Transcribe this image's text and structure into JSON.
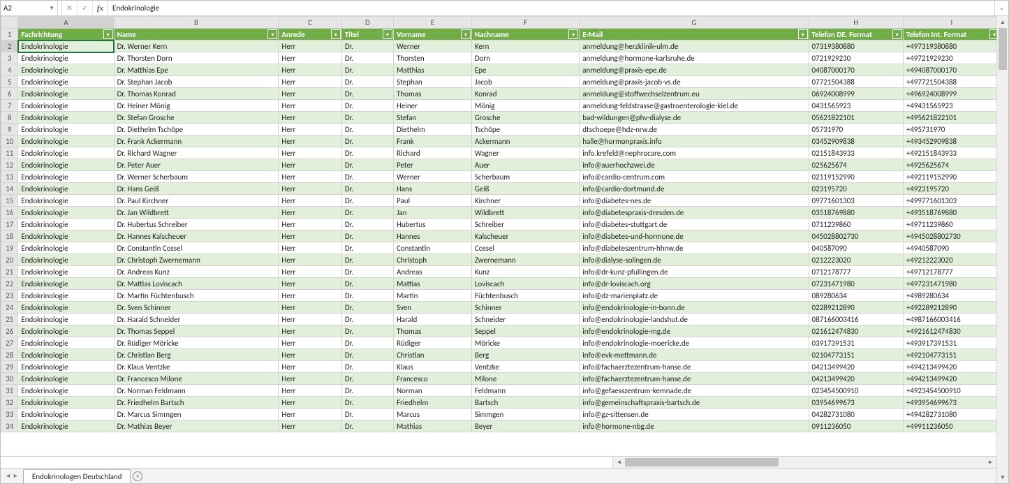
{
  "formula_bar": {
    "name_box": "A2",
    "formula": "Endokrinologie"
  },
  "sheet": {
    "tab_name": "Endokrinologen Deutschland"
  },
  "columns": [
    "A",
    "B",
    "C",
    "D",
    "E",
    "F",
    "G",
    "H",
    "I"
  ],
  "headers": {
    "A": "Fachrichtung",
    "B": "Name",
    "C": "Anrede",
    "D": "Titel",
    "E": "Vorname",
    "F": "Nachname",
    "G": "E-Mail",
    "H": "Telefon DE. Format",
    "I": "Telefon Int. Format"
  },
  "rows": [
    {
      "n": 2,
      "A": "Endokrinologie",
      "B": "Dr. Werner Kern",
      "C": "Herr",
      "D": "Dr.",
      "E": "Werner",
      "F": "Kern",
      "G": "anmeldung@herzklinik-ulm.de",
      "H": "07319380880",
      "I": "+497319380880"
    },
    {
      "n": 3,
      "A": "Endokrinologie",
      "B": "Dr. Thorsten Dorn",
      "C": "Herr",
      "D": "Dr.",
      "E": "Thorsten",
      "F": "Dorn",
      "G": "anmeldung@hormone-karlsruhe.de",
      "H": "0721929230",
      "I": "+49721929230"
    },
    {
      "n": 4,
      "A": "Endokrinologie",
      "B": "Dr. Matthias Epe",
      "C": "Herr",
      "D": "Dr.",
      "E": "Matthias",
      "F": "Epe",
      "G": "anmeldung@praxis-epe.de",
      "H": "04087000170",
      "I": "+494087000170"
    },
    {
      "n": 5,
      "A": "Endokrinologie",
      "B": "Dr. Stephan Jacob",
      "C": "Herr",
      "D": "Dr.",
      "E": "Stephan",
      "F": "Jacob",
      "G": "anmeldung@praxis-jacob-vs.de",
      "H": "07721504388",
      "I": "+497721504388"
    },
    {
      "n": 6,
      "A": "Endokrinologie",
      "B": "Dr. Thomas Konrad",
      "C": "Herr",
      "D": "Dr.",
      "E": "Thomas",
      "F": "Konrad",
      "G": "anmeldung@stoffwechselzentrum.eu",
      "H": "06924008999",
      "I": "+496924008999"
    },
    {
      "n": 7,
      "A": "Endokrinologie",
      "B": "Dr. Heiner Mönig",
      "C": "Herr",
      "D": "Dr.",
      "E": "Heiner",
      "F": "Mönig",
      "G": "anmeldung-feldstrasse@gastroenterologie-kiel.de",
      "H": "0431565923",
      "I": "+49431565923"
    },
    {
      "n": 8,
      "A": "Endokrinologie",
      "B": "Dr. Stefan Grosche",
      "C": "Herr",
      "D": "Dr.",
      "E": "Stefan",
      "F": "Grosche",
      "G": "bad-wildungen@phv-dialyse.de",
      "H": "05621822101",
      "I": "+495621822101"
    },
    {
      "n": 9,
      "A": "Endokrinologie",
      "B": "Dr. Diethelm Tschöpe",
      "C": "Herr",
      "D": "Dr.",
      "E": "Diethelm",
      "F": "Tschöpe",
      "G": "dtschoepe@hdz-nrw.de",
      "H": "05731970",
      "I": "+495731970"
    },
    {
      "n": 10,
      "A": "Endokrinologie",
      "B": "Dr. Frank Ackermann",
      "C": "Herr",
      "D": "Dr.",
      "E": "Frank",
      "F": "Ackermann",
      "G": "halle@hormonpraxis.info",
      "H": "03452909838",
      "I": "+493452909838"
    },
    {
      "n": 11,
      "A": "Endokrinologie",
      "B": "Dr. Richard Wagner",
      "C": "Herr",
      "D": "Dr.",
      "E": "Richard",
      "F": "Wagner",
      "G": "info.krefeld@nephrocare.com",
      "H": "02151843933",
      "I": "+492151843933"
    },
    {
      "n": 12,
      "A": "Endokrinologie",
      "B": "Dr. Peter Auer",
      "C": "Herr",
      "D": "Dr.",
      "E": "Peter",
      "F": "Auer",
      "G": "info@auerhochzwei.de",
      "H": "025625674",
      "I": "+4925625674"
    },
    {
      "n": 13,
      "A": "Endokrinologie",
      "B": "Dr. Werner Scherbaum",
      "C": "Herr",
      "D": "Dr.",
      "E": "Werner",
      "F": "Scherbaum",
      "G": "info@cardio-centrum.com",
      "H": "02119152990",
      "I": "+492119152990"
    },
    {
      "n": 14,
      "A": "Endokrinologie",
      "B": "Dr. Hans Geiß",
      "C": "Herr",
      "D": "Dr.",
      "E": "Hans",
      "F": "Geiß",
      "G": "info@cardio-dortmund.de",
      "H": "023195720",
      "I": "+4923195720"
    },
    {
      "n": 15,
      "A": "Endokrinologie",
      "B": "Dr. Paul Kirchner",
      "C": "Herr",
      "D": "Dr.",
      "E": "Paul",
      "F": "Kirchner",
      "G": "info@diabetes-nes.de",
      "H": "09771601303",
      "I": "+499771601303"
    },
    {
      "n": 16,
      "A": "Endokrinologie",
      "B": "Dr. Jan Wildbrett",
      "C": "Herr",
      "D": "Dr.",
      "E": "Jan",
      "F": "Wildbrett",
      "G": "info@diabetespraxis-dresden.de",
      "H": "03518769880",
      "I": "+493518769880"
    },
    {
      "n": 17,
      "A": "Endokrinologie",
      "B": "Dr. Hubertus Schreiber",
      "C": "Herr",
      "D": "Dr.",
      "E": "Hubertus",
      "F": "Schreiber",
      "G": "info@diabetes-stuttgart.de",
      "H": "0711239860",
      "I": "+49711239860"
    },
    {
      "n": 18,
      "A": "Endokrinologie",
      "B": "Dr. Hannes Kalscheuer",
      "C": "Herr",
      "D": "Dr.",
      "E": "Hannes",
      "F": "Kalscheuer",
      "G": "info@diabetes-und-hormone.de",
      "H": "045028802730",
      "I": "+4945028802730"
    },
    {
      "n": 19,
      "A": "Endokrinologie",
      "B": "Dr. Constantin Cossel",
      "C": "Herr",
      "D": "Dr.",
      "E": "Constantin",
      "F": "Cossel",
      "G": "info@diabeteszentrum-hhnw.de",
      "H": "040587090",
      "I": "+4940587090"
    },
    {
      "n": 20,
      "A": "Endokrinologie",
      "B": "Dr. Christoph Zwernemann",
      "C": "Herr",
      "D": "Dr.",
      "E": "Christoph",
      "F": "Zwernemann",
      "G": "info@dialyse-solingen.de",
      "H": "0212223020",
      "I": "+49212223020"
    },
    {
      "n": 21,
      "A": "Endokrinologie",
      "B": "Dr. Andreas Kunz",
      "C": "Herr",
      "D": "Dr.",
      "E": "Andreas",
      "F": "Kunz",
      "G": "info@dr-kunz-pfullingen.de",
      "H": "0712178777",
      "I": "+49712178777"
    },
    {
      "n": 22,
      "A": "Endokrinologie",
      "B": "Dr. Mattias Loviscach",
      "C": "Herr",
      "D": "Dr.",
      "E": "Mattias",
      "F": "Loviscach",
      "G": "info@dr-loviscach.org",
      "H": "07231471980",
      "I": "+497231471980"
    },
    {
      "n": 23,
      "A": "Endokrinologie",
      "B": "Dr. Martin Füchtenbusch",
      "C": "Herr",
      "D": "Dr.",
      "E": "Martin",
      "F": "Füchtenbusch",
      "G": "info@dz-marienplatz.de",
      "H": "089280634",
      "I": "+4989280634"
    },
    {
      "n": 24,
      "A": "Endokrinologie",
      "B": "Dr. Sven Schinner",
      "C": "Herr",
      "D": "Dr.",
      "E": "Sven",
      "F": "Schinner",
      "G": "info@endokrinologie-in-bonn.de",
      "H": "02289212890",
      "I": "+492289212890"
    },
    {
      "n": 25,
      "A": "Endokrinologie",
      "B": "Dr. Harald Schneider",
      "C": "Herr",
      "D": "Dr.",
      "E": "Harald",
      "F": "Schneider",
      "G": "info@endokrinologie-landshut.de",
      "H": "087166003416",
      "I": "+4987166003416"
    },
    {
      "n": 26,
      "A": "Endokrinologie",
      "B": "Dr. Thomas Seppel",
      "C": "Herr",
      "D": "Dr.",
      "E": "Thomas",
      "F": "Seppel",
      "G": "info@endokrinologie-mg.de",
      "H": "021612474830",
      "I": "+4921612474830"
    },
    {
      "n": 27,
      "A": "Endokrinologie",
      "B": "Dr. Rüdiger Möricke",
      "C": "Herr",
      "D": "Dr.",
      "E": "Rüdiger",
      "F": "Möricke",
      "G": "info@endokrinologie-moericke.de",
      "H": "03917391531",
      "I": "+493917391531"
    },
    {
      "n": 28,
      "A": "Endokrinologie",
      "B": "Dr. Christian Berg",
      "C": "Herr",
      "D": "Dr.",
      "E": "Christian",
      "F": "Berg",
      "G": "info@evk-mettmann.de",
      "H": "02104773151",
      "I": "+492104773151"
    },
    {
      "n": 29,
      "A": "Endokrinologie",
      "B": "Dr. Klaus Ventzke",
      "C": "Herr",
      "D": "Dr.",
      "E": "Klaus",
      "F": "Ventzke",
      "G": "info@fachaerztezentrum-hanse.de",
      "H": "04213499420",
      "I": "+494213499420"
    },
    {
      "n": 30,
      "A": "Endokrinologie",
      "B": "Dr. Francesco Milone",
      "C": "Herr",
      "D": "Dr.",
      "E": "Francesco",
      "F": "Milone",
      "G": "info@fachaerztezentrum-hanse.de",
      "H": "04213499420",
      "I": "+494213499420"
    },
    {
      "n": 31,
      "A": "Endokrinologie",
      "B": "Dr. Norman Feldmann",
      "C": "Herr",
      "D": "Dr.",
      "E": "Norman",
      "F": "Feldmann",
      "G": "info@gefaesszentrum-kemnade.de",
      "H": "023454500910",
      "I": "+4923454500910"
    },
    {
      "n": 32,
      "A": "Endokrinologie",
      "B": "Dr. Friedhelm Bartsch",
      "C": "Herr",
      "D": "Dr.",
      "E": "Friedhelm",
      "F": "Bartsch",
      "G": "info@gemeinschaftspraxis-bartsch.de",
      "H": "03954699673",
      "I": "+493954699673"
    },
    {
      "n": 33,
      "A": "Endokrinologie",
      "B": "Dr. Marcus Simmgen",
      "C": "Herr",
      "D": "Dr.",
      "E": "Marcus",
      "F": "Simmgen",
      "G": "info@gz-sittensen.de",
      "H": "04282731080",
      "I": "+494282731080"
    },
    {
      "n": 34,
      "A": "Endokrinologie",
      "B": "Dr. Mathias Beyer",
      "C": "Herr",
      "D": "Dr.",
      "E": "Mathias",
      "F": "Beyer",
      "G": "info@hormone-nbg.de",
      "H": "0911236050",
      "I": "+49911236050"
    }
  ]
}
